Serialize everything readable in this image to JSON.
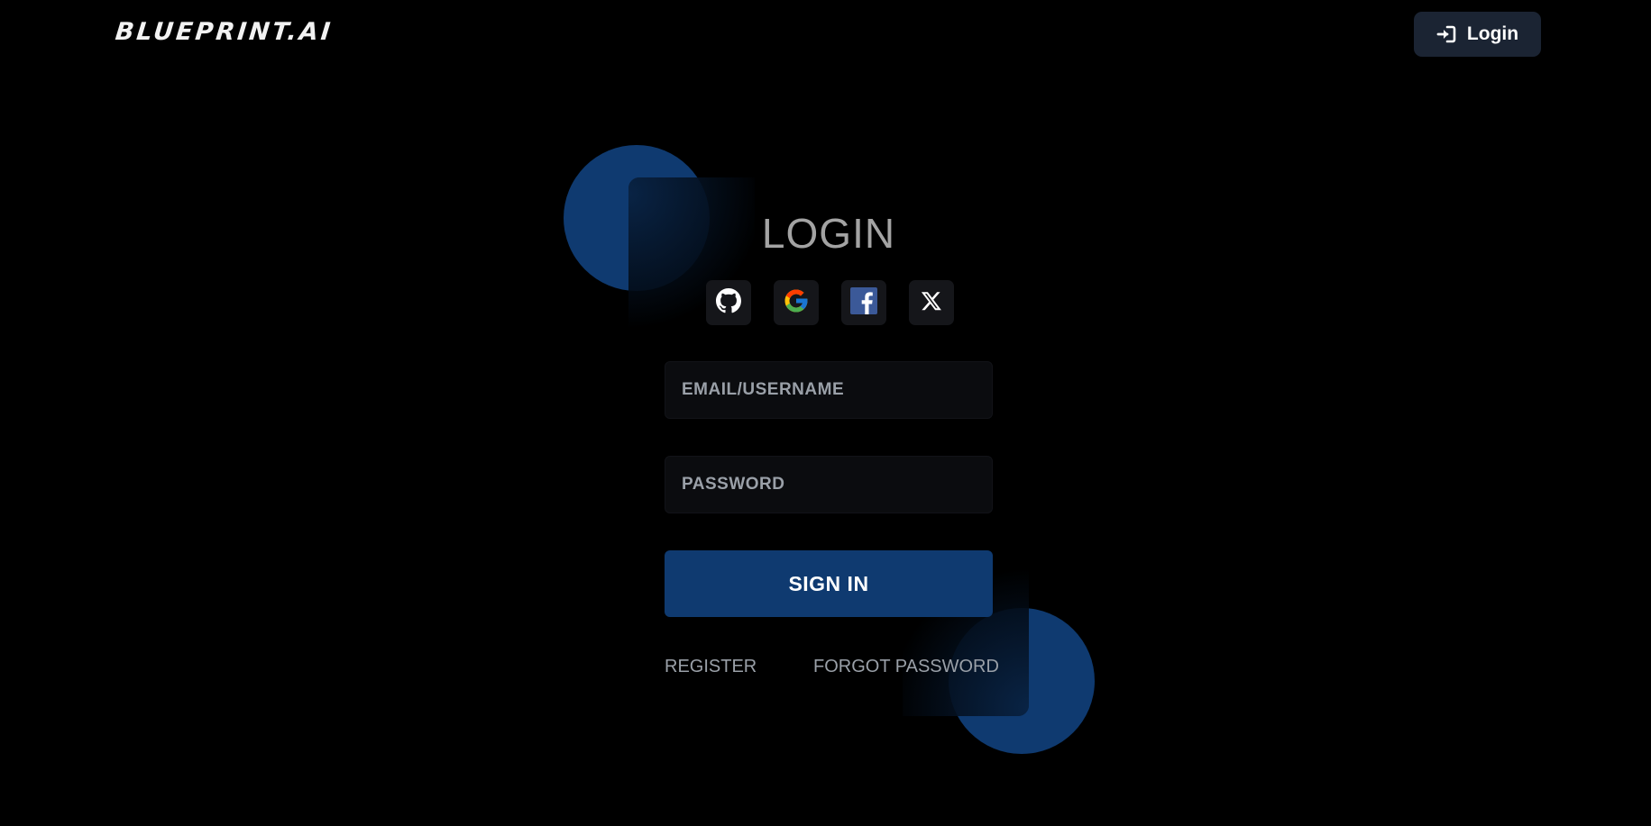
{
  "header": {
    "logo_text": "BLUEPRINT.AI",
    "login_label": "Login",
    "login_icon": "sign-in-icon"
  },
  "form": {
    "title": "LOGIN",
    "social_buttons": [
      {
        "name": "github",
        "icon": "github-icon"
      },
      {
        "name": "google",
        "icon": "google-icon"
      },
      {
        "name": "facebook",
        "icon": "facebook-icon"
      },
      {
        "name": "x",
        "icon": "x-icon"
      }
    ],
    "email_placeholder": "EMAIL/USERNAME",
    "email_value": "",
    "password_placeholder": "PASSWORD",
    "password_value": "",
    "submit_label": "SIGN IN",
    "register_label": "REGISTER",
    "forgot_label": "FORGOT PASSWORD"
  },
  "colors": {
    "background": "#000000",
    "accent": "#0f3a70",
    "nav_button": "#1b2433",
    "title_text": "#a3a3a3",
    "muted_text": "#9aa0a8"
  }
}
